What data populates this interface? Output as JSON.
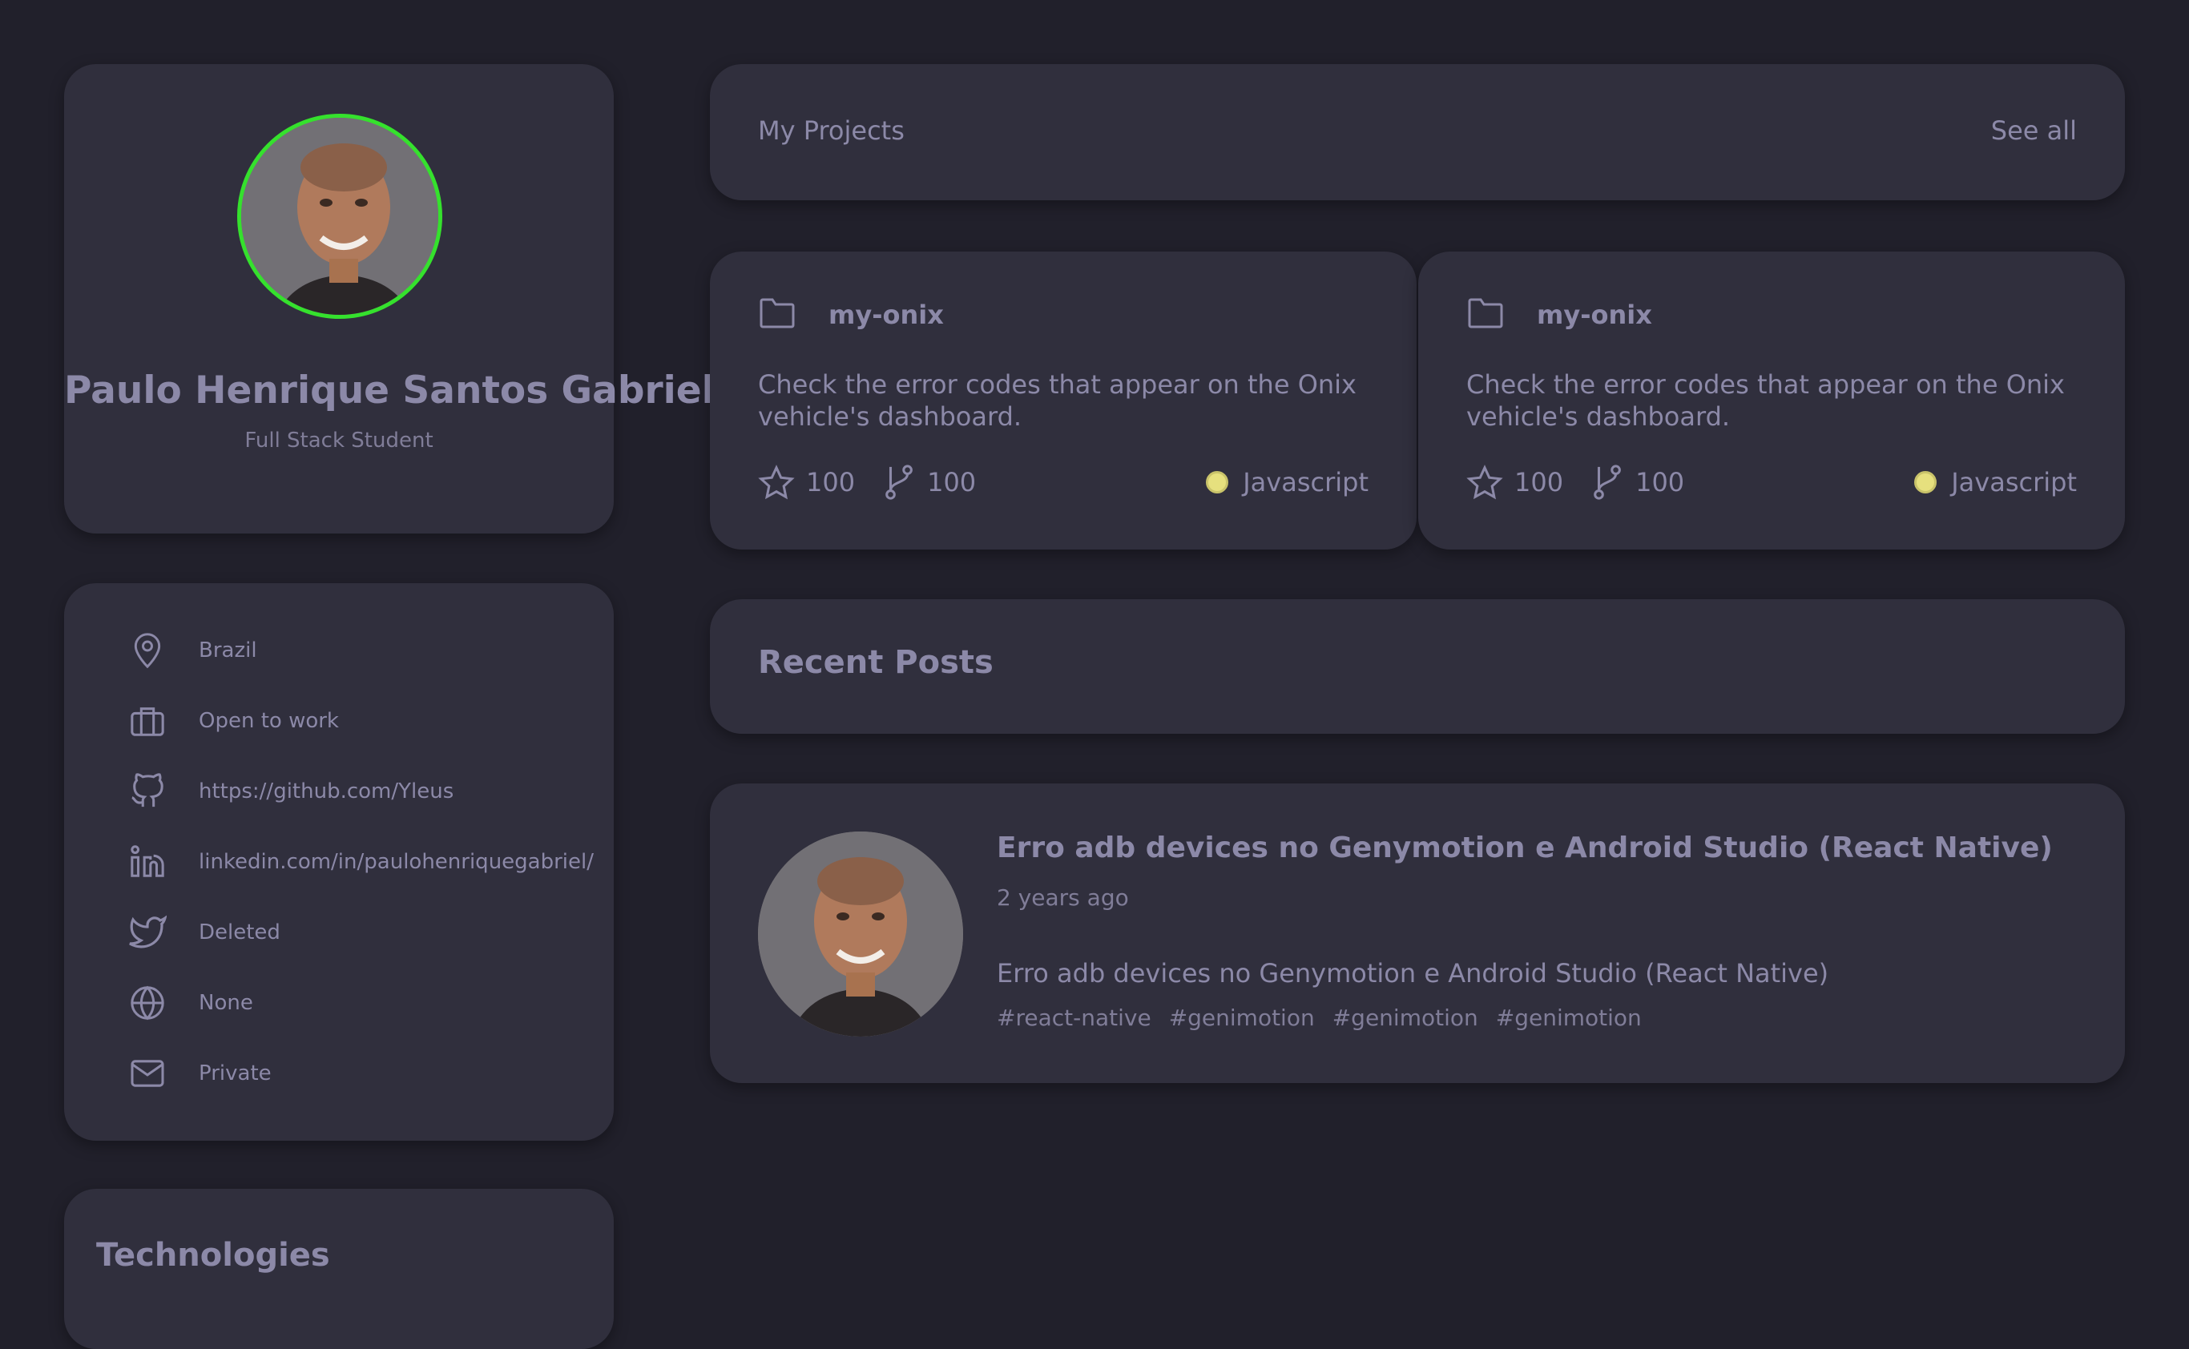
{
  "profile": {
    "name": "Paulo Henrique Santos Gabriel",
    "role": "Full Stack Student",
    "avatar_icon": "person-photo"
  },
  "info": {
    "items": [
      {
        "icon": "map-pin-icon",
        "label": "Brazil"
      },
      {
        "icon": "briefcase-icon",
        "label": "Open to work"
      },
      {
        "icon": "github-icon",
        "label": "https://github.com/Yleus"
      },
      {
        "icon": "linkedin-icon",
        "label": "linkedin.com/in/paulohenriquegabriel/"
      },
      {
        "icon": "twitter-icon",
        "label": "Deleted"
      },
      {
        "icon": "globe-icon",
        "label": "None"
      },
      {
        "icon": "mail-icon",
        "label": "Private"
      }
    ]
  },
  "technologies": {
    "title": "Technologies"
  },
  "projects": {
    "title": "My Projects",
    "see_all": "See all",
    "items": [
      {
        "name": "my-onix",
        "description": "Check the error codes that appear on the Onix vehicle's dashboard.",
        "stars": "100",
        "forks": "100",
        "language": "Javascript",
        "language_color": "#e6e07e"
      },
      {
        "name": "my-onix",
        "description": "Check the error codes that appear on the Onix vehicle's dashboard.",
        "stars": "100",
        "forks": "100",
        "language": "Javascript",
        "language_color": "#e6e07e"
      }
    ]
  },
  "posts": {
    "title": "Recent Posts",
    "items": [
      {
        "title": "Erro adb devices no Genymotion e Android Studio (React Native)",
        "date": "2 years ago",
        "body": "Erro adb devices no Genymotion e Android Studio (React Native)",
        "tags": [
          "#react-native",
          "#genimotion",
          "#genimotion",
          "#genimotion"
        ]
      }
    ]
  },
  "colors": {
    "background": "#21202b",
    "card": "#302f3d",
    "text": "#8c89a8",
    "avatar_ring": "#35e12d"
  }
}
